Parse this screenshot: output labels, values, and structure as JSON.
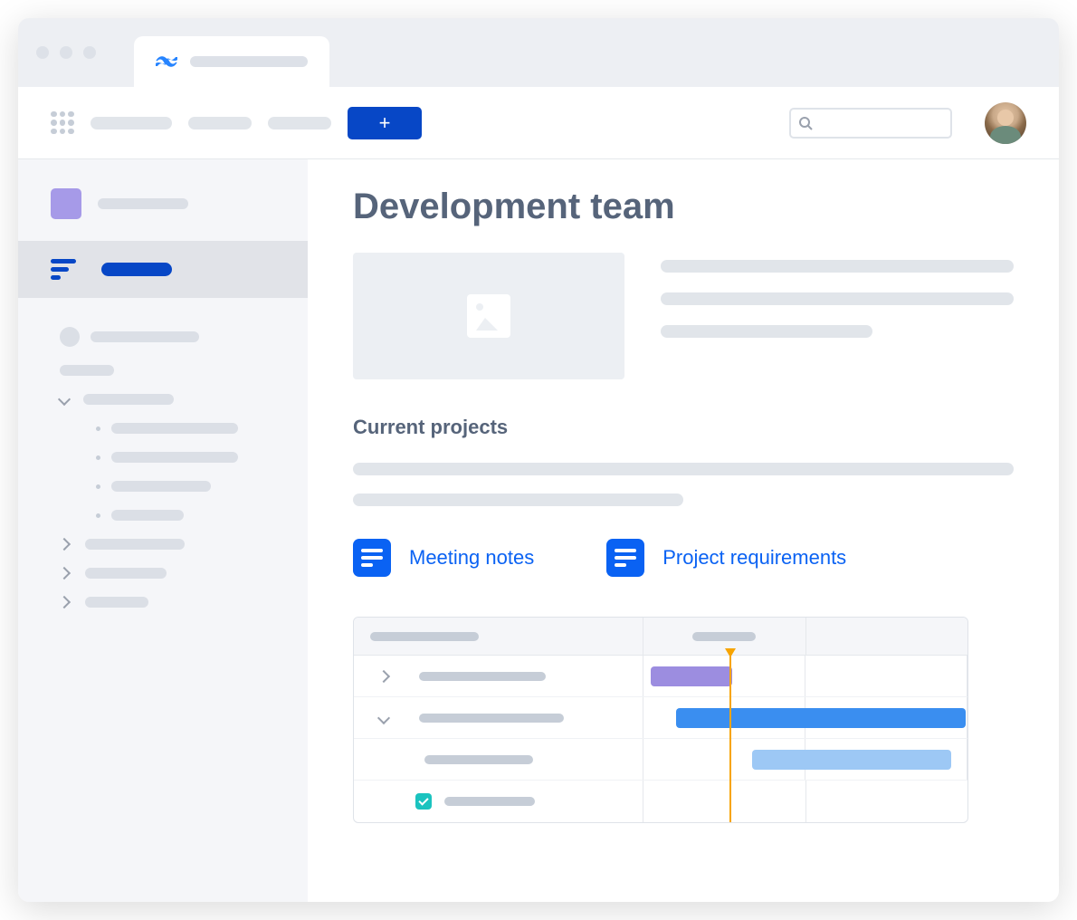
{
  "page": {
    "title": "Development team",
    "section_heading": "Current projects"
  },
  "links": {
    "meeting_notes": "Meeting notes",
    "project_requirements": "Project requirements"
  },
  "icons": {
    "app_logo": "confluence-icon",
    "create": "plus-icon",
    "search": "search-icon",
    "sort": "sort-icon",
    "image": "image-placeholder-icon",
    "doc": "document-icon",
    "check": "check-icon"
  },
  "colors": {
    "primary_blue": "#0747c6",
    "link_blue": "#0a62f3",
    "purple": "#a69ae8",
    "teal": "#1bc3bf",
    "orange": "#f7a400",
    "gantt_purple": "#9c8de0",
    "gantt_blue": "#3a8ef0",
    "gantt_lightblue": "#9dc8f5"
  }
}
